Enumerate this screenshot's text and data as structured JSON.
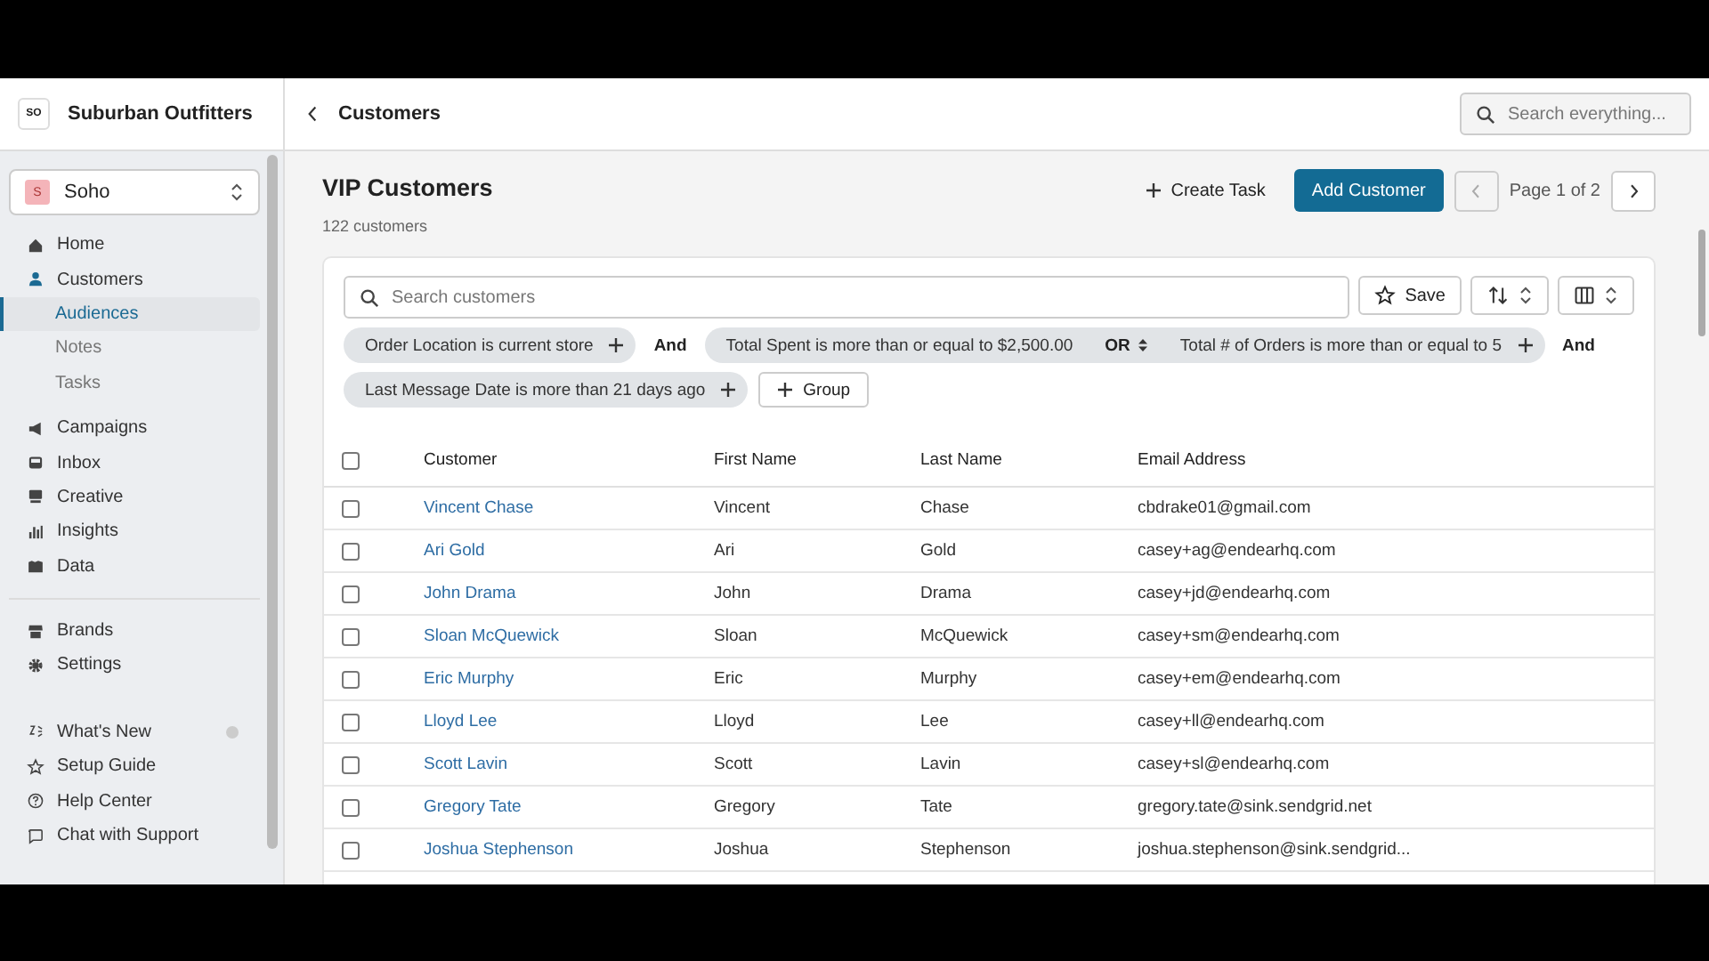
{
  "brand": {
    "logo": "SO",
    "name": "Suburban Outfitters"
  },
  "store": {
    "initial": "S",
    "name": "Soho"
  },
  "nav_sections": [
    {
      "items": [
        {
          "kind": "item",
          "label": "Home",
          "selected": false
        },
        {
          "kind": "item",
          "label": "Customers",
          "selected": true
        },
        {
          "kind": "sub",
          "label": "Audiences",
          "selected": true
        },
        {
          "kind": "sub",
          "label": "Notes",
          "selected": false
        },
        {
          "kind": "sub",
          "label": "Tasks",
          "selected": false
        }
      ]
    },
    {
      "items": [
        {
          "kind": "item",
          "label": "Campaigns",
          "selected": false
        },
        {
          "kind": "item",
          "label": "Inbox",
          "selected": false
        },
        {
          "kind": "item",
          "label": "Creative",
          "selected": false
        },
        {
          "kind": "item",
          "label": "Insights",
          "selected": false
        },
        {
          "kind": "item",
          "label": "Data",
          "selected": false
        }
      ]
    },
    {
      "items": [
        {
          "kind": "item",
          "label": "Brands",
          "selected": false
        },
        {
          "kind": "item",
          "label": "Settings",
          "selected": false
        }
      ]
    },
    {
      "items": [
        {
          "kind": "item",
          "label": "What's New",
          "selected": false,
          "dot": true
        },
        {
          "kind": "item",
          "label": "Setup Guide",
          "selected": false
        },
        {
          "kind": "item",
          "label": "Help Center",
          "selected": false
        },
        {
          "kind": "item",
          "label": "Chat with Support",
          "selected": false
        }
      ]
    }
  ],
  "topbar": {
    "back_title": "Customers",
    "search": {
      "placeholder": "Search everything..."
    }
  },
  "page": {
    "title": "VIP Customers",
    "subtitle": "122 customers",
    "create_task": "Create Task",
    "add_customer": "Add Customer",
    "pagination": "Page 1 of 2"
  },
  "filters": {
    "search": {
      "placeholder": "Search customers"
    },
    "save": "Save",
    "items": [
      {
        "kind": "chip",
        "label": "Order Location is current store"
      },
      {
        "kind": "joiner",
        "label": "And"
      },
      {
        "kind": "group",
        "parts": [
          "Total Spent is more than or equal to $2,500.00",
          "Total # of Orders is more than or equal to 5"
        ],
        "operator": "OR"
      },
      {
        "kind": "joiner",
        "label": "And"
      },
      {
        "kind": "chip",
        "label": "Last Message Date is more than 21 days ago"
      },
      {
        "kind": "add",
        "label": "Group"
      }
    ]
  },
  "table": {
    "columns": [
      "Customer",
      "First Name",
      "Last Name",
      "Email Address"
    ],
    "all_checked": false,
    "rows": [
      {
        "checked": false,
        "cells": [
          "Vincent Chase",
          "Vincent",
          "Chase",
          "cbdrake01@gmail.com"
        ]
      },
      {
        "checked": false,
        "cells": [
          "Ari Gold",
          "Ari",
          "Gold",
          "casey+ag@endearhq.com"
        ]
      },
      {
        "checked": false,
        "cells": [
          "John Drama",
          "John",
          "Drama",
          "casey+jd@endearhq.com"
        ]
      },
      {
        "checked": false,
        "cells": [
          "Sloan McQuewick",
          "Sloan",
          "McQuewick",
          "casey+sm@endearhq.com"
        ]
      },
      {
        "checked": false,
        "cells": [
          "Eric Murphy",
          "Eric",
          "Murphy",
          "casey+em@endearhq.com"
        ]
      },
      {
        "checked": false,
        "cells": [
          "Lloyd Lee",
          "Lloyd",
          "Lee",
          "casey+ll@endearhq.com"
        ]
      },
      {
        "checked": false,
        "cells": [
          "Scott Lavin",
          "Scott",
          "Lavin",
          "casey+sl@endearhq.com"
        ]
      },
      {
        "checked": false,
        "cells": [
          "Gregory Tate",
          "Gregory",
          "Tate",
          "gregory.tate@sink.sendgrid.net"
        ]
      },
      {
        "checked": false,
        "cells": [
          "Joshua Stephenson",
          "Joshua",
          "Stephenson",
          "joshua.stephenson@sink.sendgrid..."
        ]
      }
    ]
  }
}
